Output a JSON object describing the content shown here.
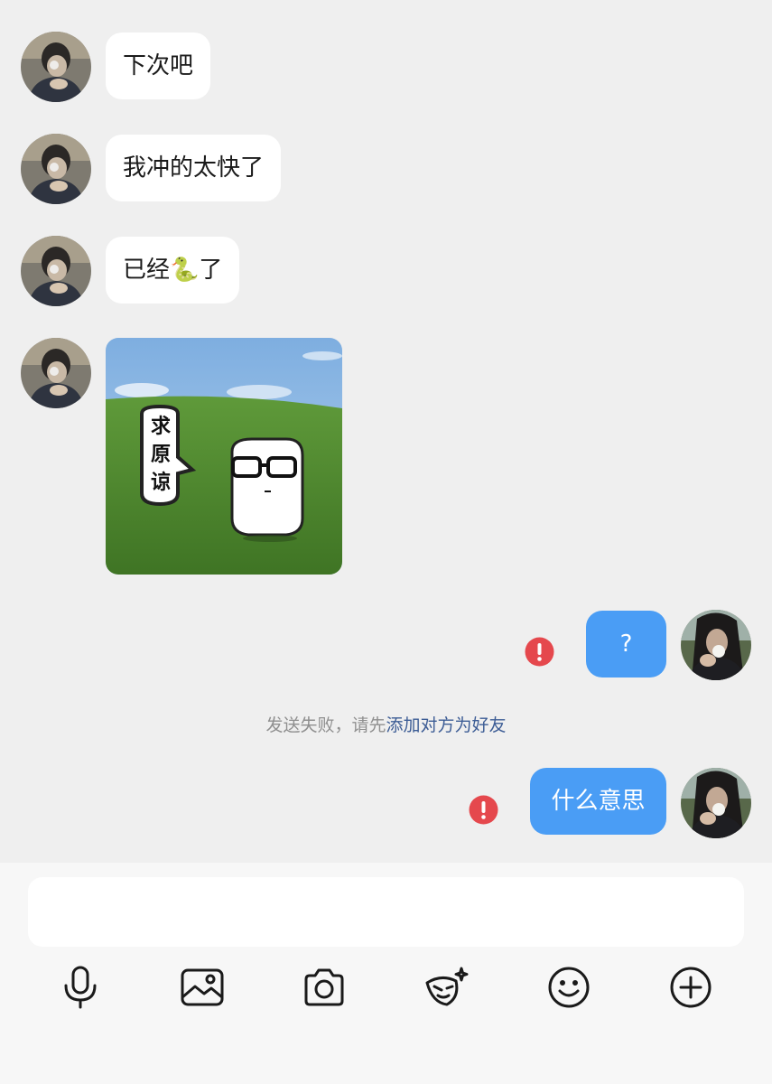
{
  "messages": [
    {
      "direction": "in",
      "type": "text",
      "text": "下次吧"
    },
    {
      "direction": "in",
      "type": "text",
      "text": "我冲的太快了"
    },
    {
      "direction": "in",
      "type": "text",
      "text": "已经",
      "emoji": "🐍",
      "text_after": "了"
    },
    {
      "direction": "in",
      "type": "sticker",
      "sticker_text": "求原谅"
    },
    {
      "direction": "out",
      "type": "text",
      "text": "?",
      "status": "failed"
    },
    {
      "direction": "out",
      "type": "text",
      "text": "什么意思",
      "status": "failed"
    }
  ],
  "system_notice": {
    "prefix": "发送失败，请先",
    "link": "添加对方为好友"
  },
  "colors": {
    "chat_background": "#efefef",
    "incoming_bubble": "#ffffff",
    "outgoing_bubble": "#4a9df5",
    "error": "#e5484d",
    "link": "#3c5c95"
  },
  "toolbar": {
    "icons": [
      "microphone-icon",
      "image-icon",
      "camera-icon",
      "mask-effect-icon",
      "smiley-icon",
      "plus-icon"
    ]
  }
}
